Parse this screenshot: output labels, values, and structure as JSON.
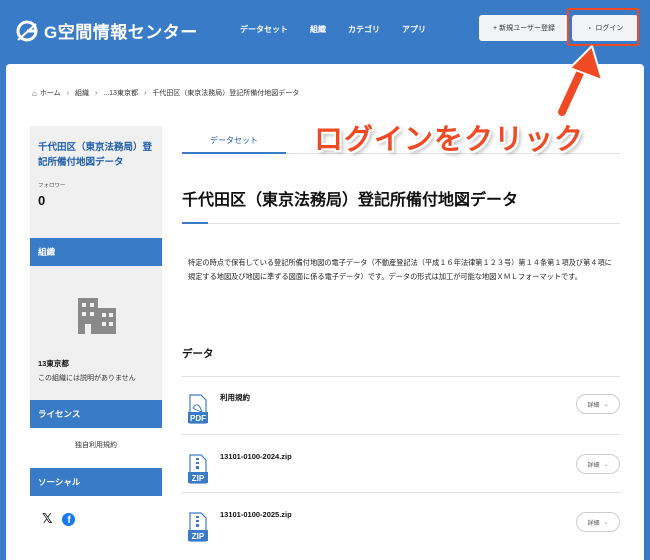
{
  "header": {
    "logo_text": "G空間情報センター",
    "nav": [
      "データセット",
      "組織",
      "カテゴリ",
      "アプリ"
    ],
    "register_label": "+ 新規ユーザー登録",
    "login_label": "ログイン"
  },
  "breadcrumb": [
    "ホーム",
    "組織",
    "...13東京都",
    "千代田区（東京法務局）登記所備付地図データ"
  ],
  "sidebar": {
    "title": "千代田区（東京法務局）登記所備付地図データ",
    "follow_label": "フォロワー",
    "follow_count": "0",
    "org_heading": "組織",
    "org_name": "13東京都",
    "org_desc": "この組織には説明がありません",
    "license_heading": "ライセンス",
    "license_value": "独自利用規約",
    "social_heading": "ソーシャル"
  },
  "content": {
    "tab_label": "データセット",
    "title": "千代田区（東京法務局）登記所備付地図データ",
    "description": "特定の時点で保有している登記所備付地図の電子データ（不動産登記法（平成１６年法律第１２３号）第１４条第１項及び第４項に規定する地図及び地図に準ずる図面に係る電子データ）です。データの形式は加工が可能な地図ＸＭＬフォーマットです。",
    "data_heading": "データ",
    "resources": [
      {
        "name": "利用規約",
        "format": "PDF",
        "detail_label": "詳細"
      },
      {
        "name": "13101-0100-2024.zip",
        "format": "ZIP",
        "detail_label": "詳細"
      },
      {
        "name": "13101-0100-2025.zip",
        "format": "ZIP",
        "detail_label": "詳細"
      }
    ]
  },
  "annotation": {
    "text": "ログインをクリック",
    "color": "#f04a24"
  },
  "colors": {
    "brand": "#3a7bc8",
    "accent_text": "#1f5fa8"
  }
}
